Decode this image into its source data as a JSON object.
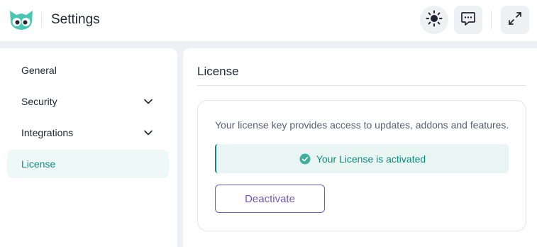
{
  "header": {
    "title": "Settings",
    "logo_icon": "owl-logo-icon",
    "buttons": {
      "theme_icon": "sun-icon",
      "feedback_icon": "chat-bubble-icon",
      "expand_icon": "expand-icon"
    }
  },
  "sidebar": {
    "items": [
      {
        "label": "General",
        "expandable": false,
        "active": false
      },
      {
        "label": "Security",
        "expandable": true,
        "active": false
      },
      {
        "label": "Integrations",
        "expandable": true,
        "active": false
      },
      {
        "label": "License",
        "expandable": false,
        "active": true
      }
    ]
  },
  "main": {
    "title": "License",
    "card": {
      "description": "Your license key provides access to updates, addons and features.",
      "status_text": "Your License is activated",
      "status_icon": "check-circle-icon",
      "deactivate_label": "Deactivate"
    }
  },
  "colors": {
    "accent": "#0f8c80",
    "active_bg": "#eef8f6",
    "status_bg": "#e8f5f3",
    "button_purple": "#6c5bbf",
    "page_bg": "#eef0f5"
  }
}
